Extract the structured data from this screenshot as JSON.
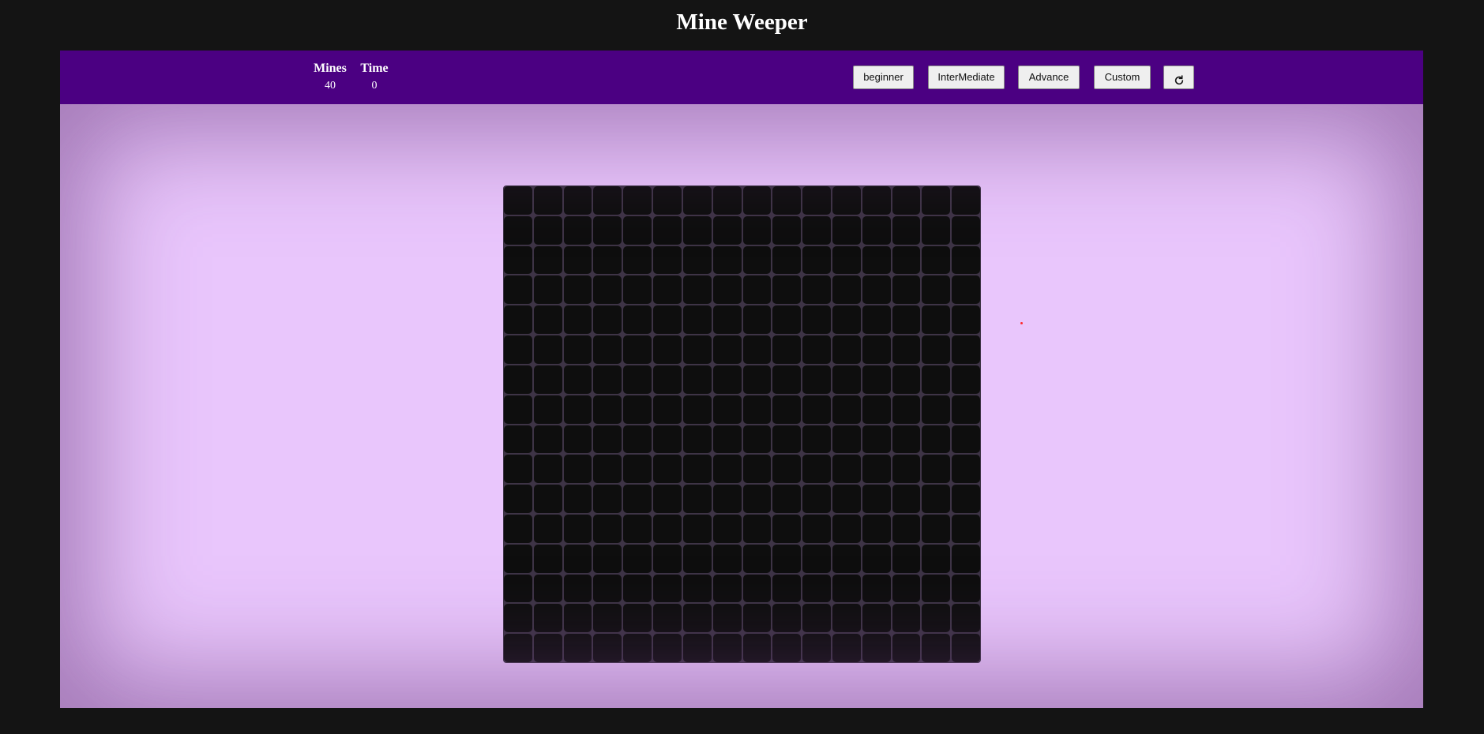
{
  "page": {
    "title": "Mine Weeper"
  },
  "header": {
    "mines_label": "Mines",
    "mines_value": "40",
    "time_label": "Time",
    "time_value": "0"
  },
  "controls": {
    "beginner_label": "beginner",
    "intermediate_label": "InterMediate",
    "advance_label": "Advance",
    "custom_label": "Custom",
    "reset_icon": "refresh-icon"
  },
  "board": {
    "rows": 16,
    "cols": 16,
    "cell_state": "unrevealed"
  },
  "colors": {
    "page_background": "#141414",
    "topbar": "#4b0082",
    "playfield": "#e9c6fc",
    "cell": "#0e0e0e",
    "grid_lines": "#3e3446"
  }
}
